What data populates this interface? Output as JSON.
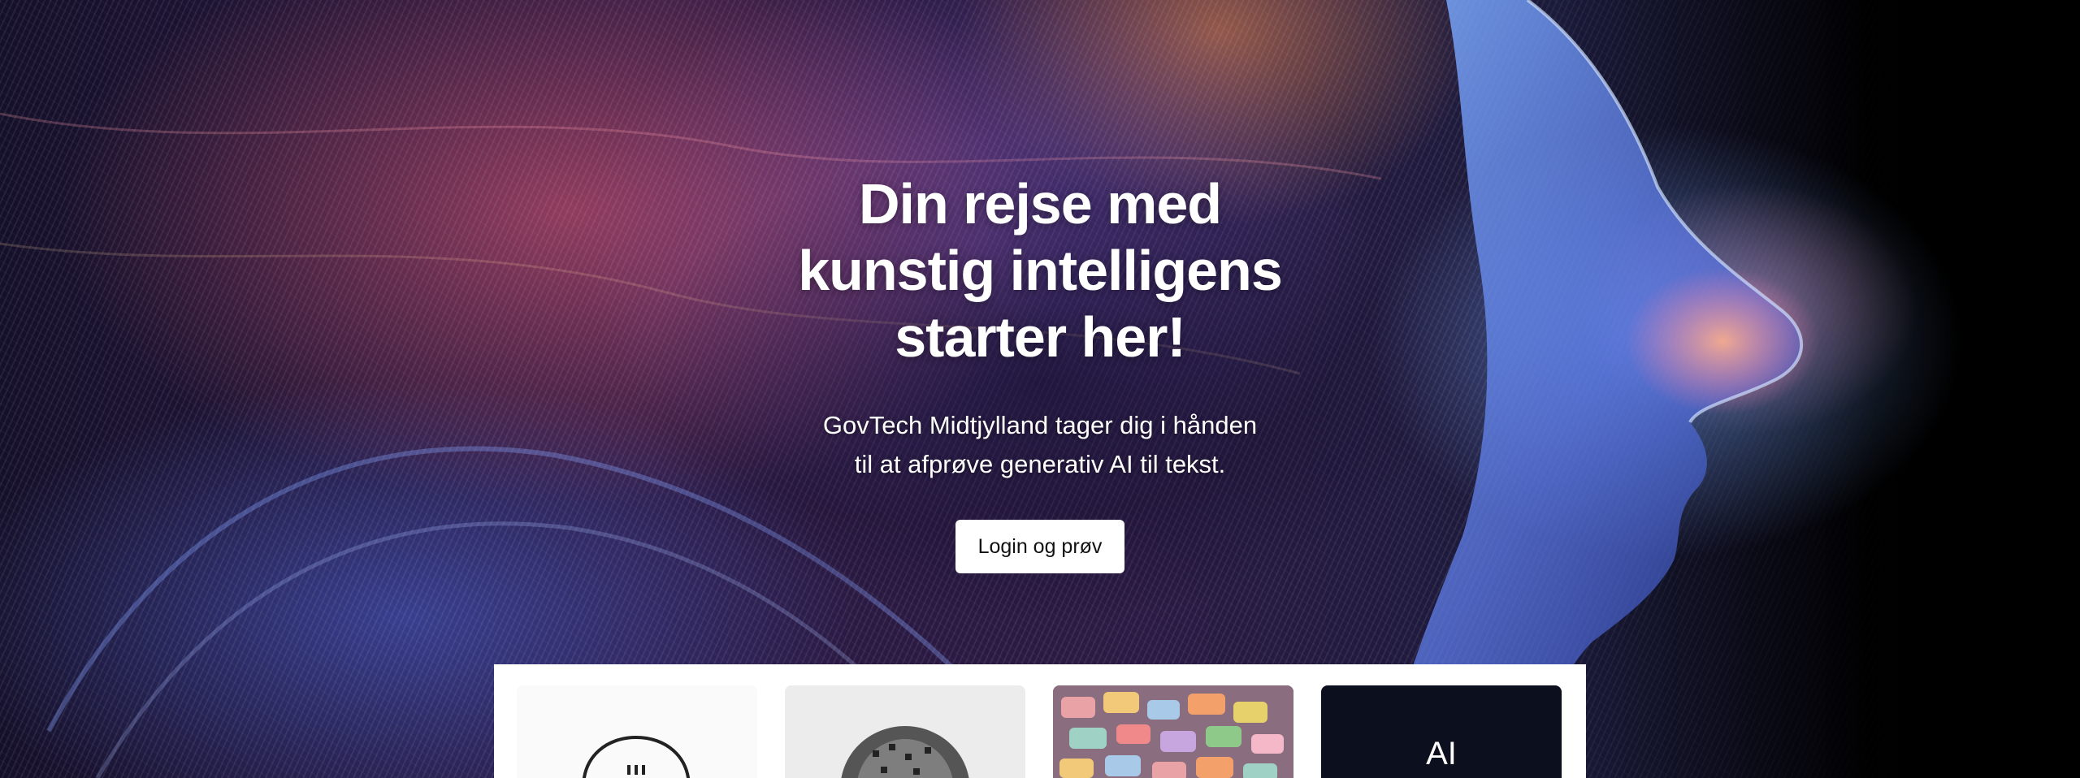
{
  "hero": {
    "title_lines": [
      "Din rejse med",
      "kunstig intelligens",
      "starter her!"
    ],
    "subtitle_lines": [
      "GovTech Midtjylland tager dig i hånden",
      "til at afprøve generativ AI til tekst."
    ],
    "cta_label": "Login og prøv"
  },
  "cards": [
    {
      "icon": "chat-bubble-icon"
    },
    {
      "icon": "brain-pattern-image"
    },
    {
      "icon": "speech-bubbles-image"
    },
    {
      "label": "AI"
    }
  ],
  "colors": {
    "page_bg": "#000000",
    "cta_bg": "#ffffff",
    "cta_text": "#111111",
    "title_text": "#ffffff"
  }
}
